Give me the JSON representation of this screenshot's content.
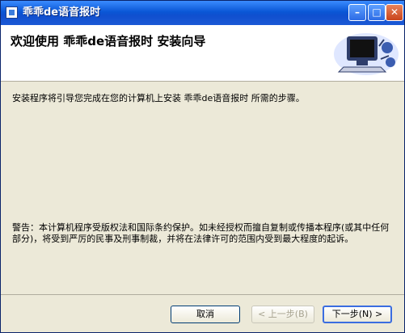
{
  "window": {
    "title": "乖乖de语音报时",
    "controls": {
      "minimize": "–",
      "maximize": "□",
      "close": "✕"
    }
  },
  "header": {
    "heading": "欢迎使用  乖乖de语音报时  安装向导",
    "icon": "computer-setup-icon"
  },
  "body": {
    "intro": "安装程序将引导您完成在您的计算机上安装 乖乖de语音报时 所需的步骤。",
    "warning": "警告：本计算机程序受版权法和国际条约保护。如未经授权而擅自复制或传播本程序(或其中任何部分)，将受到严厉的民事及刑事制裁，并将在法律许可的范围内受到最大程度的起诉。"
  },
  "buttons": {
    "cancel": "取消",
    "back": "< 上一步(B)",
    "next": "下一步(N) >"
  }
}
